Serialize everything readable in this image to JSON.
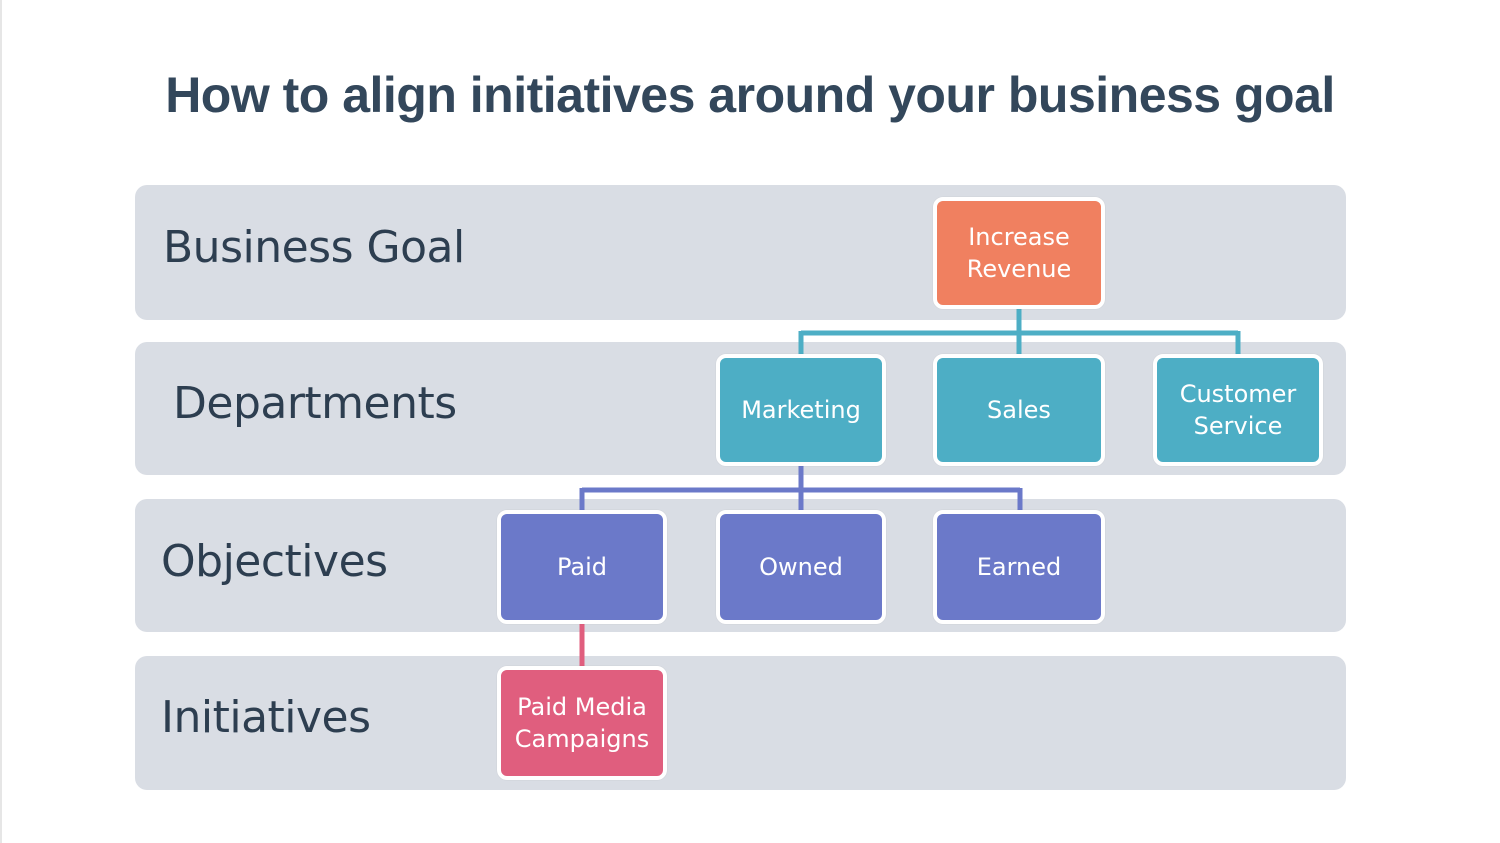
{
  "title": "How to align initiatives around your business goal",
  "levels": [
    {
      "label": "Business Goal"
    },
    {
      "label": "Departments"
    },
    {
      "label": "Objectives"
    },
    {
      "label": "Initiatives"
    }
  ],
  "nodes": {
    "goal": {
      "label": "Increase\nRevenue",
      "color": "#f08060"
    },
    "departments": [
      {
        "label": "Marketing",
        "color": "#4daec5"
      },
      {
        "label": "Sales",
        "color": "#4daec5"
      },
      {
        "label": "Customer\nService",
        "color": "#4daec5"
      }
    ],
    "objectives": [
      {
        "label": "Paid",
        "color": "#6b79c9"
      },
      {
        "label": "Owned",
        "color": "#6b79c9"
      },
      {
        "label": "Earned",
        "color": "#6b79c9"
      }
    ],
    "initiatives": [
      {
        "label": "Paid Media\nCampaigns",
        "color": "#e05e7e"
      }
    ]
  },
  "edges": [
    {
      "from": "Increase Revenue",
      "to": "Marketing"
    },
    {
      "from": "Increase Revenue",
      "to": "Sales"
    },
    {
      "from": "Increase Revenue",
      "to": "Customer Service"
    },
    {
      "from": "Marketing",
      "to": "Paid"
    },
    {
      "from": "Marketing",
      "to": "Owned"
    },
    {
      "from": "Marketing",
      "to": "Earned"
    },
    {
      "from": "Paid",
      "to": "Paid Media Campaigns"
    }
  ],
  "colors": {
    "title": "#33475b",
    "band": "#d9dde4",
    "teal_connector": "#4daec5",
    "purple_connector": "#6b79c9",
    "pink_connector": "#e05e7e"
  }
}
